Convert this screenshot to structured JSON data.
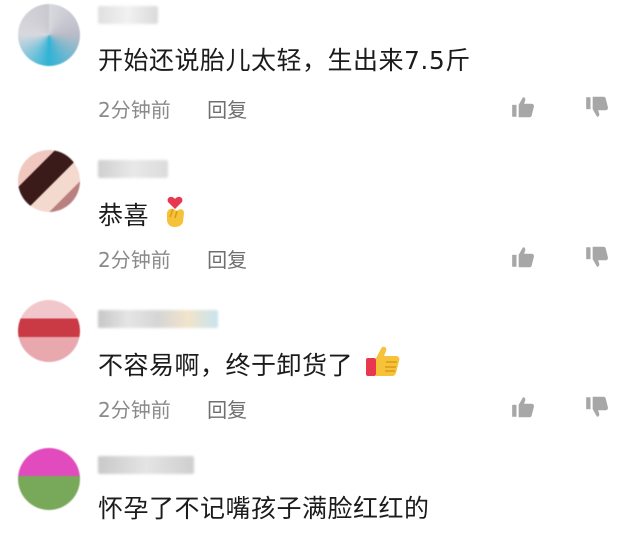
{
  "comments": [
    {
      "text": "开始还说胎儿太轻，生出来7.5斤",
      "time": "2分钟前",
      "reply": "回复",
      "emoji": ""
    },
    {
      "text": "恭喜",
      "time": "2分钟前",
      "reply": "回复",
      "emoji": "finger-heart"
    },
    {
      "text": "不容易啊，终于卸货了",
      "time": "2分钟前",
      "reply": "回复",
      "emoji": "thumbs-up"
    },
    {
      "text": "怀孕了不记嘴孩子满脸红红的",
      "time": "",
      "reply": "",
      "emoji": ""
    }
  ],
  "icons": {
    "like": "thumbs-up-outline-icon",
    "dislike": "thumbs-down-outline-icon"
  },
  "colors": {
    "text": "#1b1b1b",
    "meta": "#8a8a8a",
    "icon": "#a7a7a7"
  }
}
